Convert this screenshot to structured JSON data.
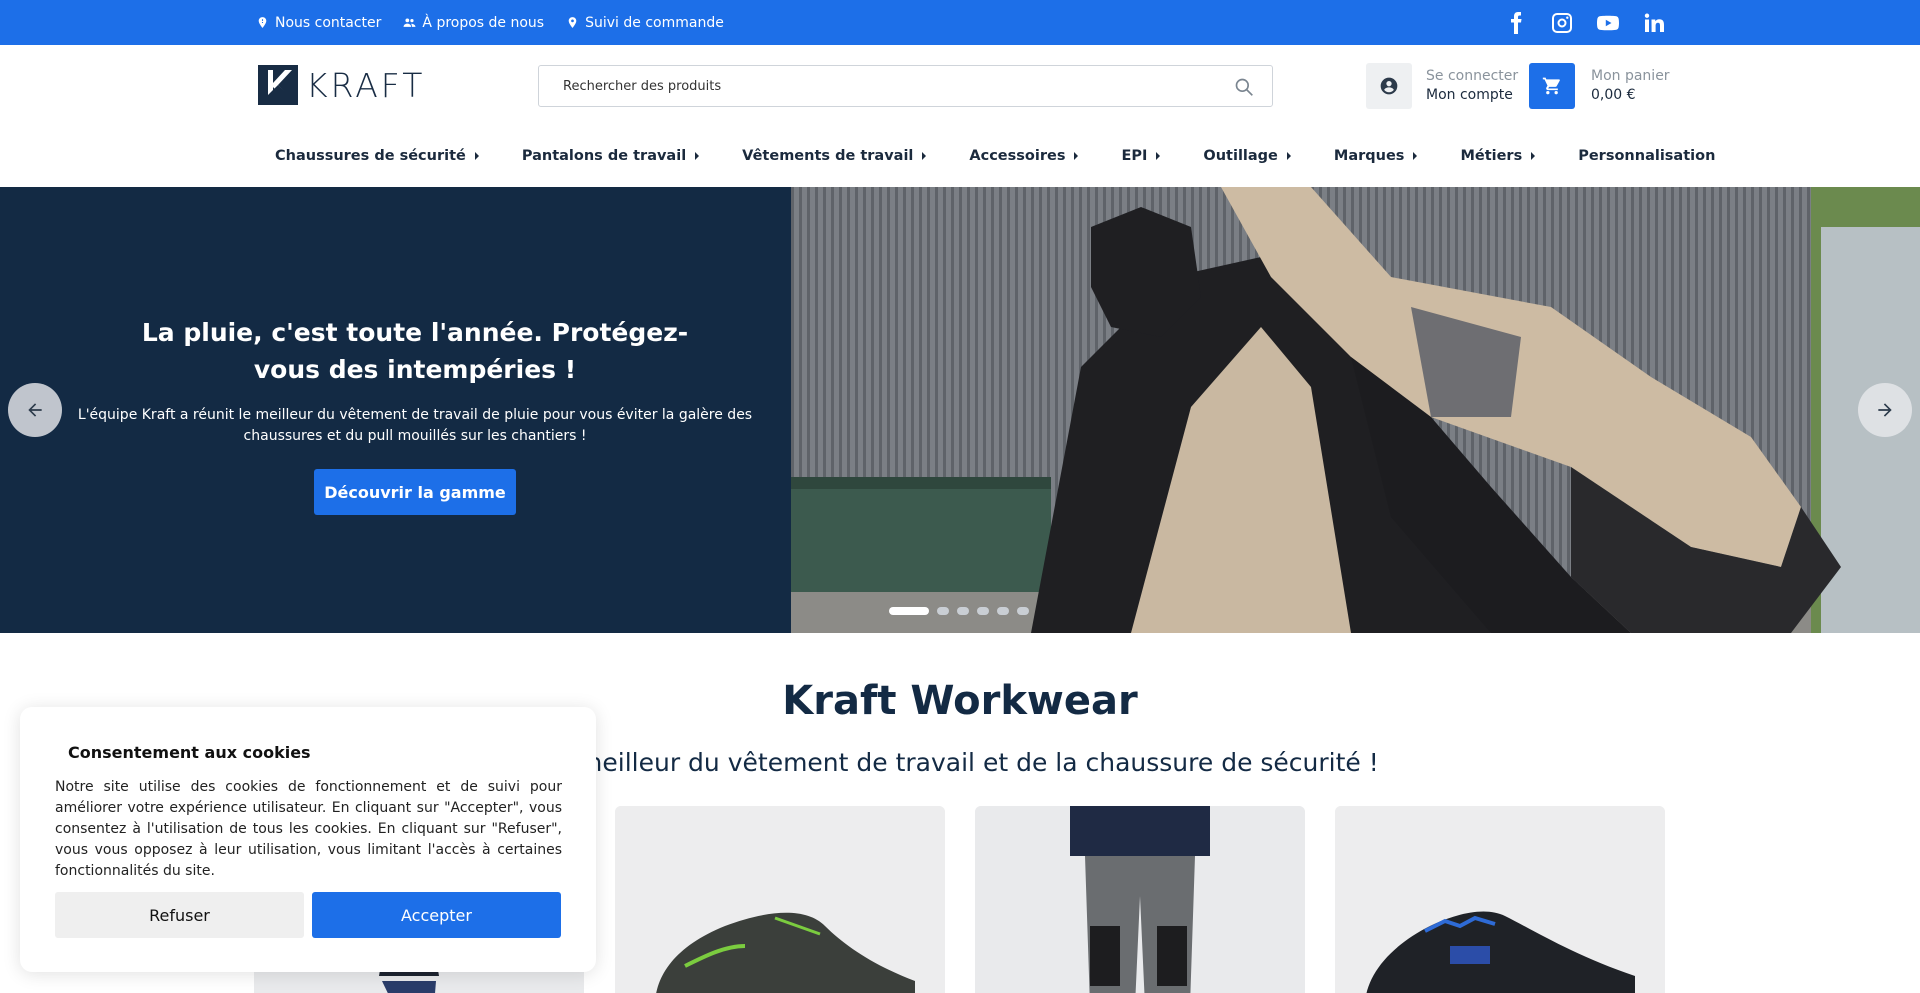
{
  "topbar": {
    "links": [
      {
        "label": "Nous contacter",
        "icon": "map-pin-icon"
      },
      {
        "label": "À propos de nous",
        "icon": "people-icon"
      },
      {
        "label": "Suivi de commande",
        "icon": "location-icon"
      }
    ],
    "social": [
      "facebook-icon",
      "instagram-icon",
      "youtube-icon",
      "linkedin-icon"
    ],
    "color": "#1d6fe8"
  },
  "header": {
    "brand": "KRAFT",
    "search_placeholder": "Rechercher des produits",
    "account_line1": "Se connecter",
    "account_line2": "Mon compte",
    "cart_line1": "Mon panier",
    "cart_line2": "0,00 €"
  },
  "nav": {
    "items": [
      {
        "label": "Chaussures de sécurité",
        "caret": true
      },
      {
        "label": "Pantalons de travail",
        "caret": true
      },
      {
        "label": "Vêtements de travail",
        "caret": true
      },
      {
        "label": "Accessoires",
        "caret": true
      },
      {
        "label": "EPI",
        "caret": true
      },
      {
        "label": "Outillage",
        "caret": true
      },
      {
        "label": "Marques",
        "caret": true
      },
      {
        "label": "Métiers",
        "caret": true
      },
      {
        "label": "Personnalisation",
        "caret": false
      }
    ]
  },
  "hero": {
    "title": "La pluie, c'est toute l'année. Protégez-vous des intempéries !",
    "text": "L'équipe Kraft a réunit le meilleur du vêtement de travail de pluie pour vous éviter la galère des chaussures et du pull mouillés sur les chantiers !",
    "cta": "Découvrir la gamme",
    "slides": 6,
    "active_slide": 1,
    "bg_color": "#132a44"
  },
  "content": {
    "title": "Kraft Workwear",
    "subtitle": "Le meilleur du vêtement de travail et de la chaussure de sécurité !"
  },
  "cookie": {
    "title": "Consentement aux cookies",
    "text": "Notre site utilise des cookies de fonctionnement et de suivi pour améliorer votre expérience utilisateur. En cliquant sur \"Accepter\", vous consentez à l'utilisation de tous les cookies. En cliquant sur \"Refuser\", vous vous opposez à leur utilisation, vous limitant l'accès à certaines fonctionnalités du site.",
    "refuse": "Refuser",
    "accept": "Accepter"
  }
}
